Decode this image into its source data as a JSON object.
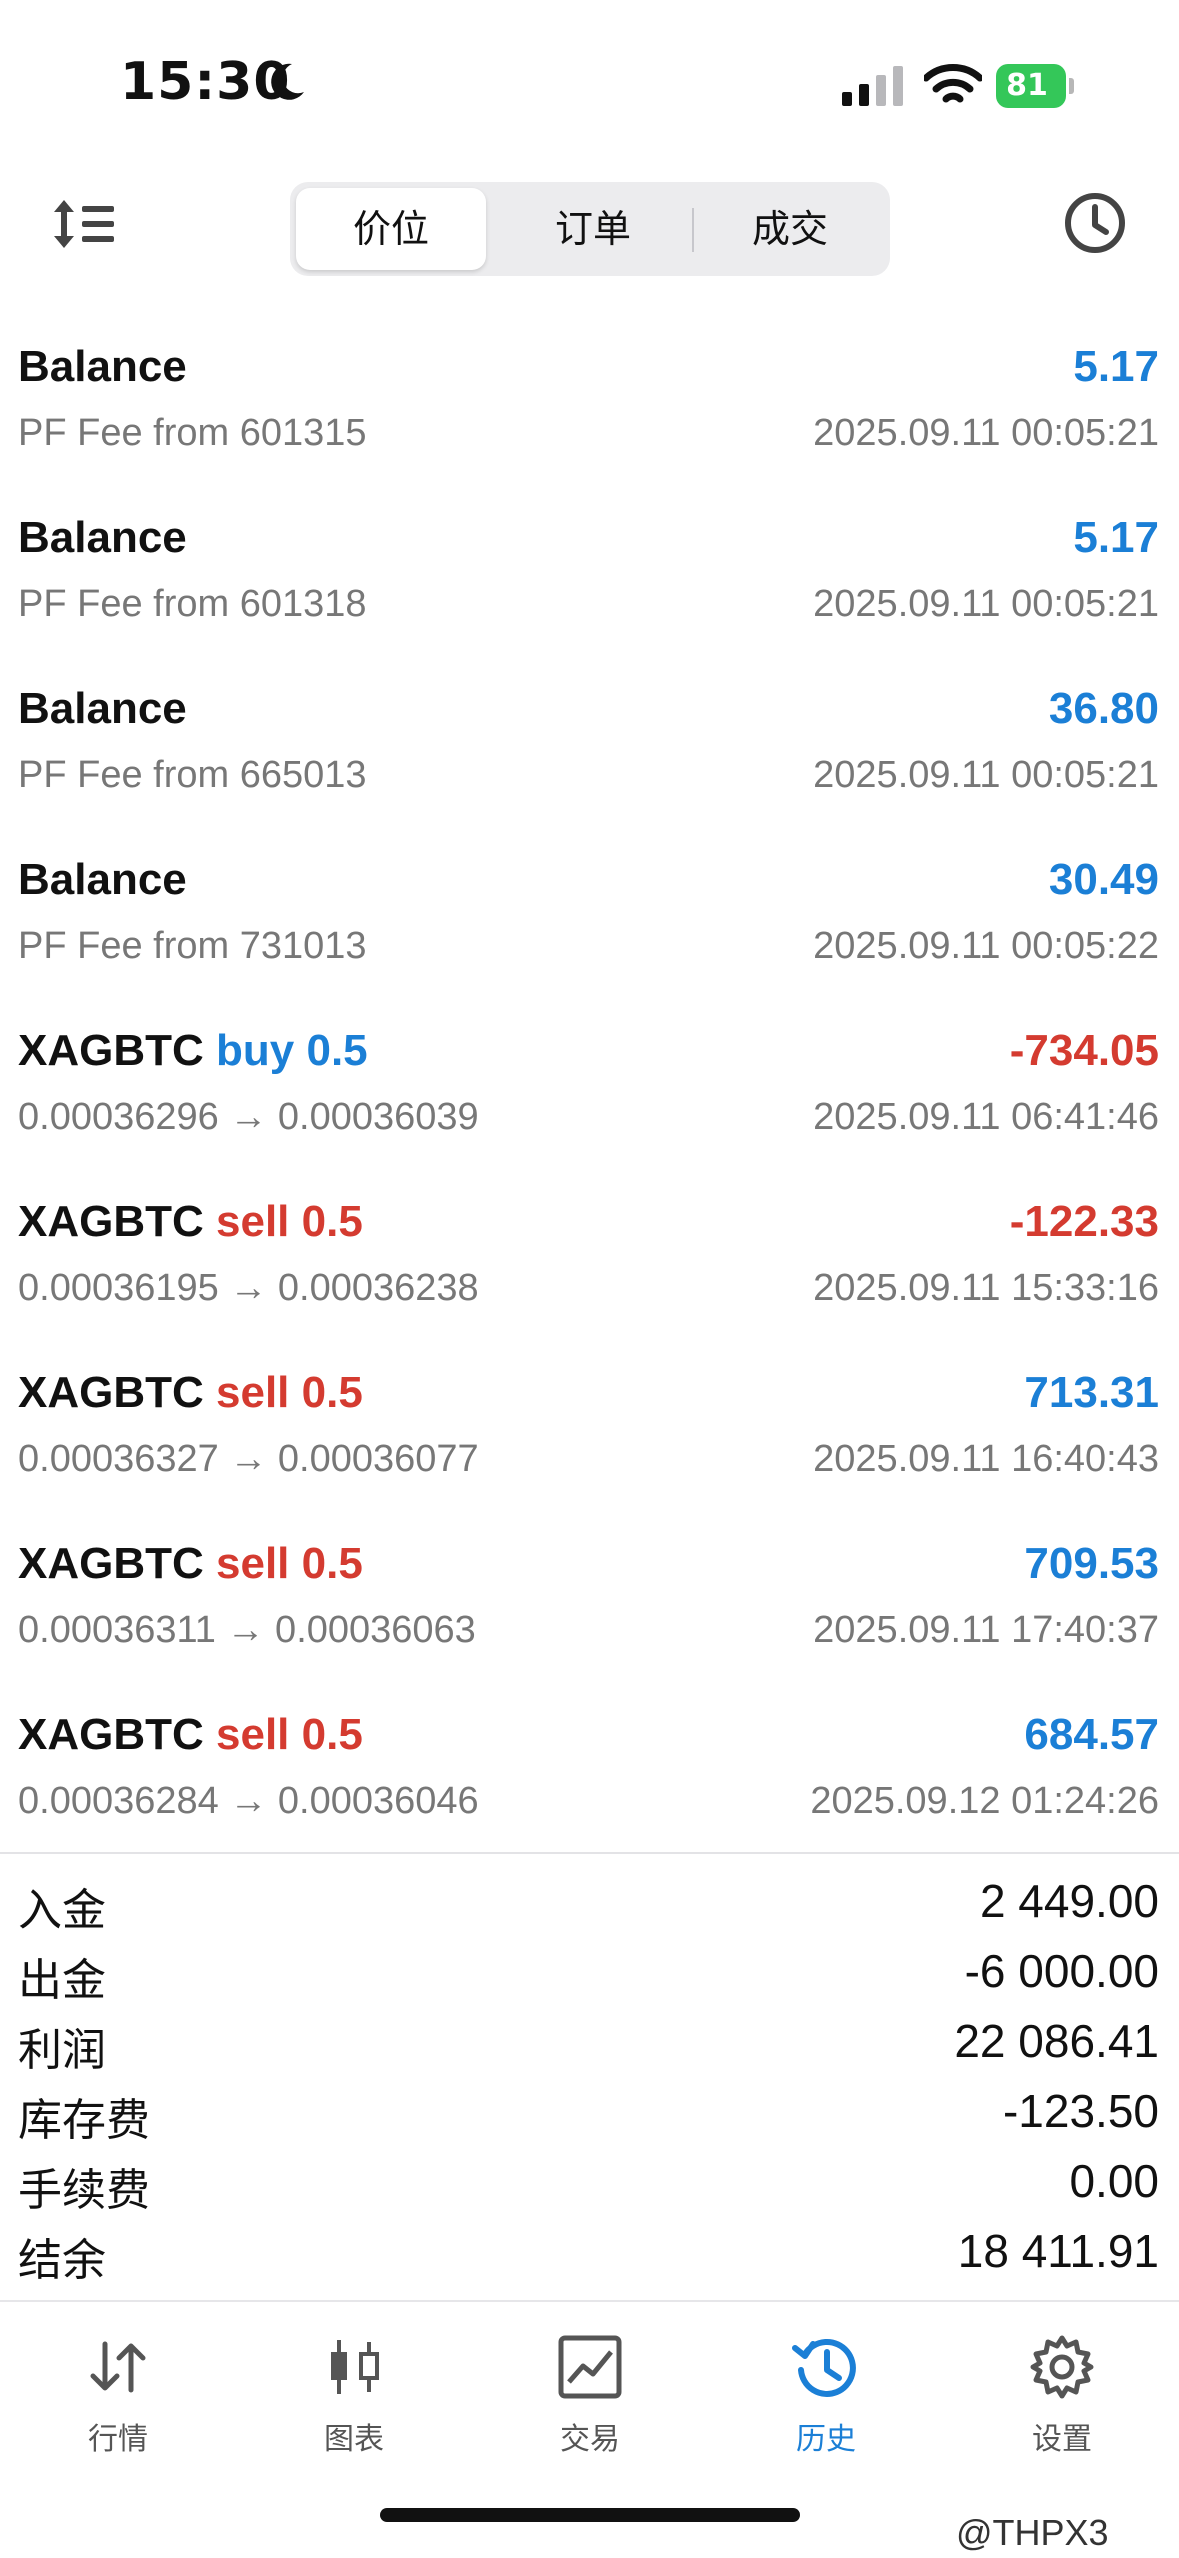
{
  "status_bar": {
    "time": "15:30",
    "battery": "81"
  },
  "segmented": {
    "tabs": [
      "价位",
      "订单",
      "成交"
    ],
    "active": 0
  },
  "deals": [
    {
      "title": "Balance",
      "side": "",
      "volume": "",
      "subtitle": "PF Fee from 601315",
      "amount": "5.17",
      "sign": "pos",
      "time": "2025.09.11 00:05:21"
    },
    {
      "title": "Balance",
      "side": "",
      "volume": "",
      "subtitle": "PF Fee from 601318",
      "amount": "5.17",
      "sign": "pos",
      "time": "2025.09.11 00:05:21"
    },
    {
      "title": "Balance",
      "side": "",
      "volume": "",
      "subtitle": "PF Fee from 665013",
      "amount": "36.80",
      "sign": "pos",
      "time": "2025.09.11 00:05:21"
    },
    {
      "title": "Balance",
      "side": "",
      "volume": "",
      "subtitle": "PF Fee from 731013",
      "amount": "30.49",
      "sign": "pos",
      "time": "2025.09.11 00:05:22"
    },
    {
      "title": "XAGBTC",
      "side": "buy",
      "volume": "0.5",
      "subtitle": "0.00036296 → 0.00036039",
      "amount": "-734.05",
      "sign": "neg",
      "time": "2025.09.11 06:41:46"
    },
    {
      "title": "XAGBTC",
      "side": "sell",
      "volume": "0.5",
      "subtitle": "0.00036195 → 0.00036238",
      "amount": "-122.33",
      "sign": "neg",
      "time": "2025.09.11 15:33:16"
    },
    {
      "title": "XAGBTC",
      "side": "sell",
      "volume": "0.5",
      "subtitle": "0.00036327 → 0.00036077",
      "amount": "713.31",
      "sign": "pos",
      "time": "2025.09.11 16:40:43"
    },
    {
      "title": "XAGBTC",
      "side": "sell",
      "volume": "0.5",
      "subtitle": "0.00036311 → 0.00036063",
      "amount": "709.53",
      "sign": "pos",
      "time": "2025.09.11 17:40:37"
    },
    {
      "title": "XAGBTC",
      "side": "sell",
      "volume": "0.5",
      "subtitle": "0.00036284 → 0.00036046",
      "amount": "684.57",
      "sign": "pos",
      "time": "2025.09.12 01:24:26"
    }
  ],
  "summary": [
    {
      "label": "入金",
      "value": "2 449.00"
    },
    {
      "label": "出金",
      "value": "-6 000.00"
    },
    {
      "label": "利润",
      "value": "22 086.41"
    },
    {
      "label": "库存费",
      "value": "-123.50"
    },
    {
      "label": "手续费",
      "value": "0.00"
    },
    {
      "label": "结余",
      "value": "18 411.91"
    }
  ],
  "tab_bar": {
    "tabs": [
      {
        "label": "行情",
        "icon": "quotes-icon"
      },
      {
        "label": "图表",
        "icon": "candlestick-chart-icon"
      },
      {
        "label": "交易",
        "icon": "trade-chart-icon"
      },
      {
        "label": "历史",
        "icon": "history-icon"
      },
      {
        "label": "设置",
        "icon": "settings-gear-icon"
      }
    ],
    "active": 3
  },
  "watermark": "@THPX3",
  "colors": {
    "accent_blue": "#1b7fd6",
    "loss_red": "#d43b30",
    "battery_green": "#34c759"
  }
}
